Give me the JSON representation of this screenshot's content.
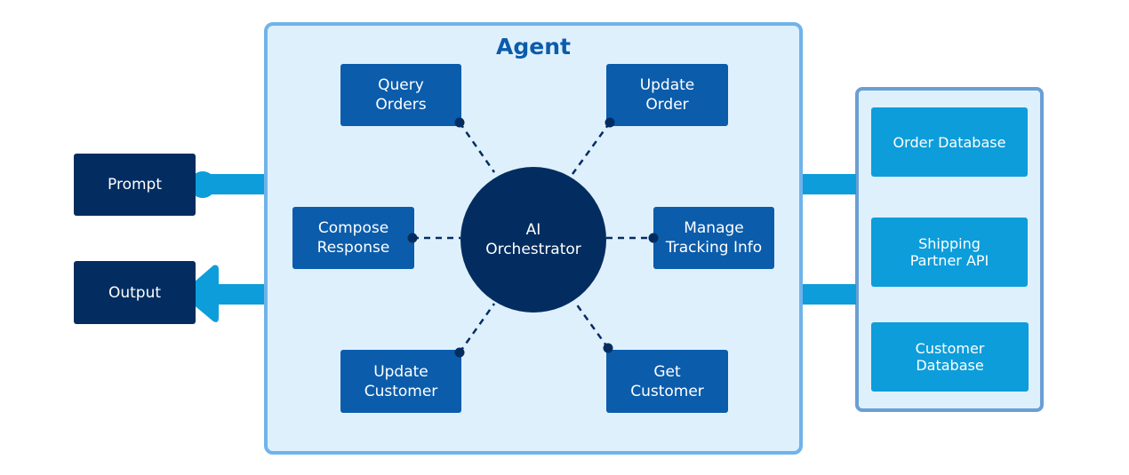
{
  "agent": {
    "title": "Agent"
  },
  "inputs": {
    "prompt": "Prompt",
    "output": "Output"
  },
  "orchestrator": {
    "label": "AI\nOrchestrator"
  },
  "tools": [
    {
      "label": "Query\nOrders"
    },
    {
      "label": "Update\nOrder"
    },
    {
      "label": "Compose\nResponse"
    },
    {
      "label": "Manage\nTracking Info"
    },
    {
      "label": "Update\nCustomer"
    },
    {
      "label": "Get\nCustomer"
    }
  ],
  "resources": [
    {
      "label": "Order Database"
    },
    {
      "label": "Shipping\nPartner API"
    },
    {
      "label": "Customer\nDatabase"
    }
  ],
  "colors": {
    "navy": "#032d60",
    "tool_blue": "#0b5cab",
    "connector": "#0d9dda",
    "agent_fill": "#dff0fd",
    "agent_border": "#6fb3ea"
  }
}
